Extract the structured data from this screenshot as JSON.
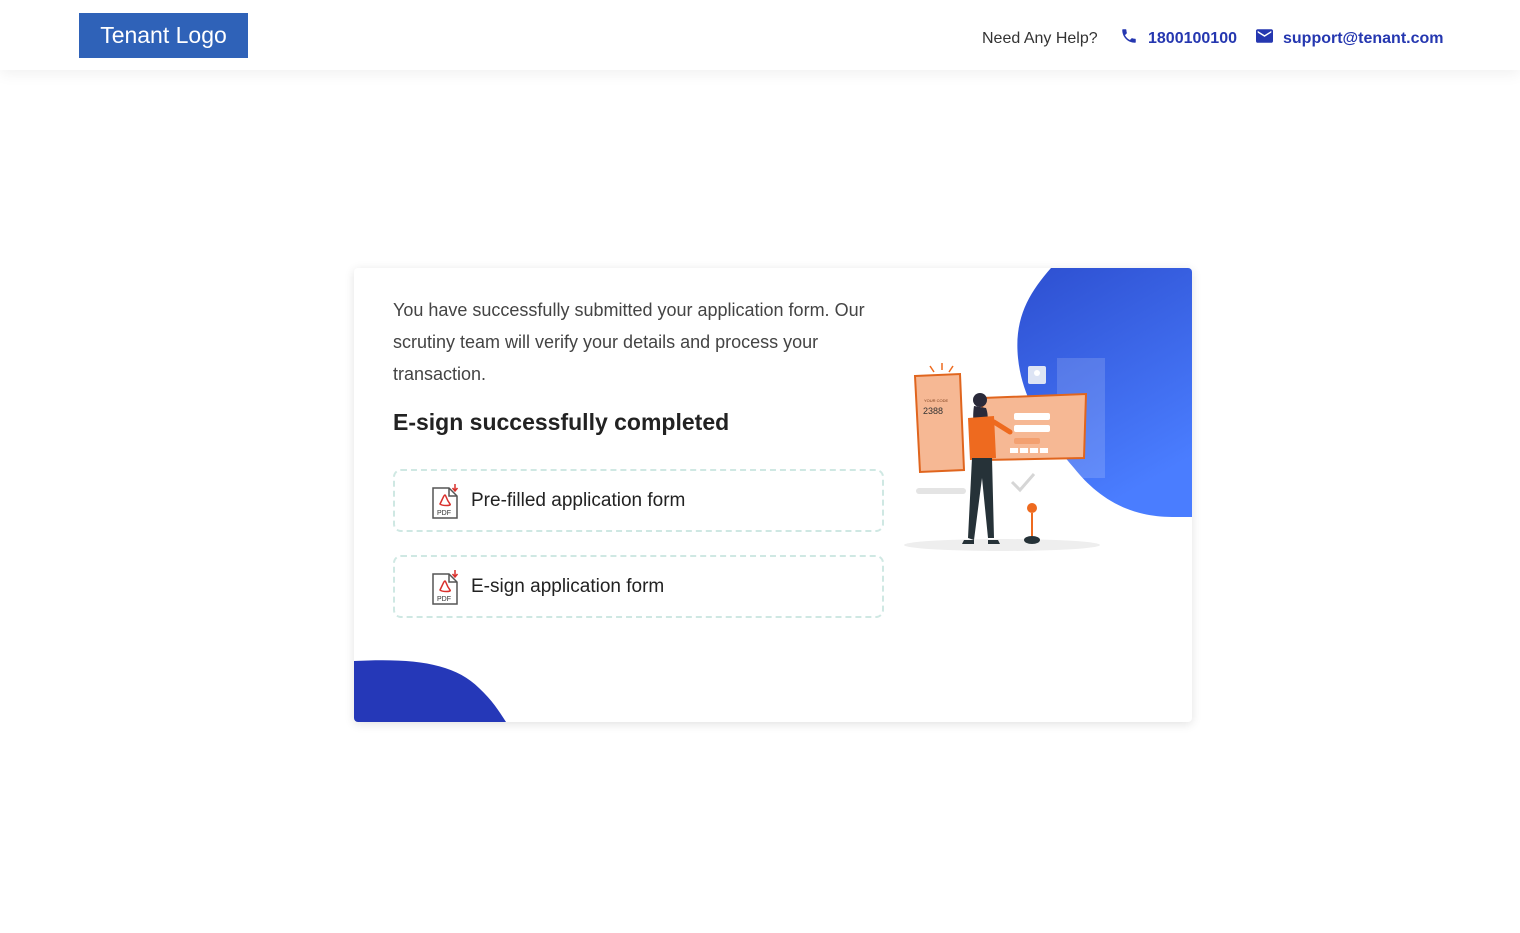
{
  "header": {
    "logo_text": "Tenant Logo",
    "help_label": "Need Any Help?",
    "phone": "1800100100",
    "email": "support@tenant.com",
    "phone_icon": "phone-icon",
    "email_icon": "mail-icon"
  },
  "card": {
    "message": "You have successfully submitted your application form. Our scrutiny team will verify your details and process your transaction.",
    "heading": "E-sign successfully completed",
    "documents": [
      {
        "label": "Pre-filled application form",
        "icon": "pdf-icon"
      },
      {
        "label": "E-sign application form",
        "icon": "pdf-icon"
      }
    ],
    "illustration": {
      "code_label": "YOUR CODE",
      "code": "2388"
    }
  },
  "colors": {
    "brand_blue": "#2537b0",
    "logo_blue": "#2f62b8",
    "accent_orange": "#f07b3f",
    "dashed_border": "#cfe8e3"
  }
}
